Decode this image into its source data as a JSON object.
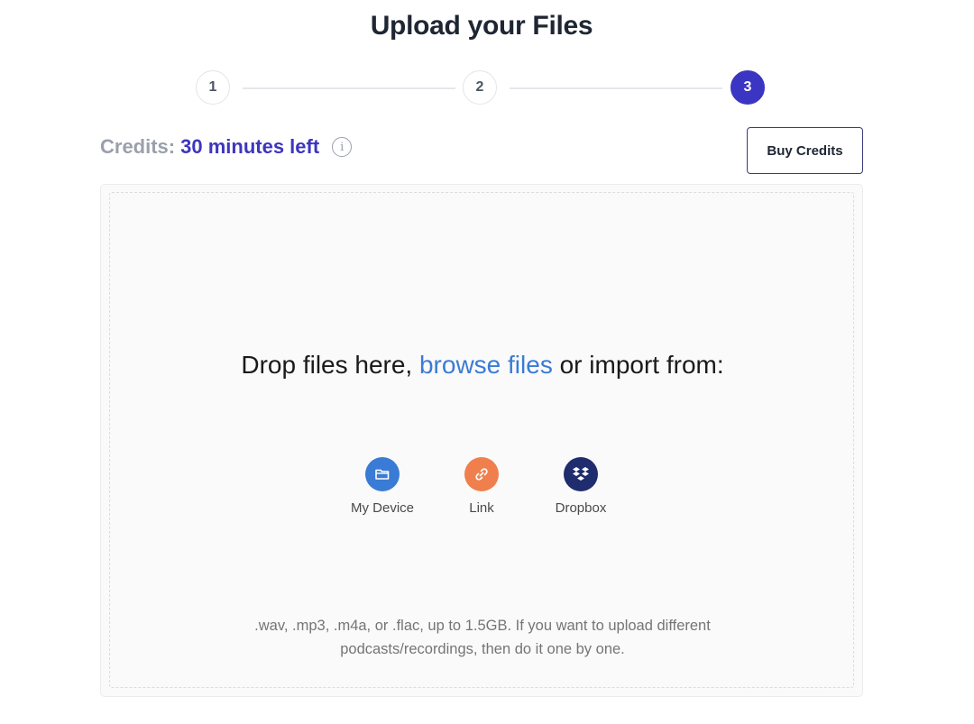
{
  "page": {
    "title": "Upload your Files"
  },
  "stepper": {
    "steps": [
      {
        "label": "1",
        "active": false
      },
      {
        "label": "2",
        "active": false
      },
      {
        "label": "3",
        "active": true
      }
    ]
  },
  "credits": {
    "label": "Credits:",
    "value": "30 minutes left",
    "info_icon": "info-icon"
  },
  "buy_button": {
    "label": "Buy Credits"
  },
  "dropzone": {
    "text_before": "Drop files here, ",
    "browse_link": "browse files",
    "text_after": " or import from:",
    "sources": [
      {
        "label": "My Device",
        "icon": "folder-icon",
        "color": "#3a7bd5"
      },
      {
        "label": "Link",
        "icon": "link-icon",
        "color": "#f07f4e"
      },
      {
        "label": "Dropbox",
        "icon": "dropbox-icon",
        "color": "#1f2c6e"
      }
    ],
    "hint": ".wav, .mp3, .m4a, or .flac, up to 1.5GB. If you want to upload different podcasts/recordings, then do it one by one."
  },
  "colors": {
    "accent": "#3b35c3",
    "link": "#3a7bd5",
    "muted": "#9aa0ab"
  }
}
